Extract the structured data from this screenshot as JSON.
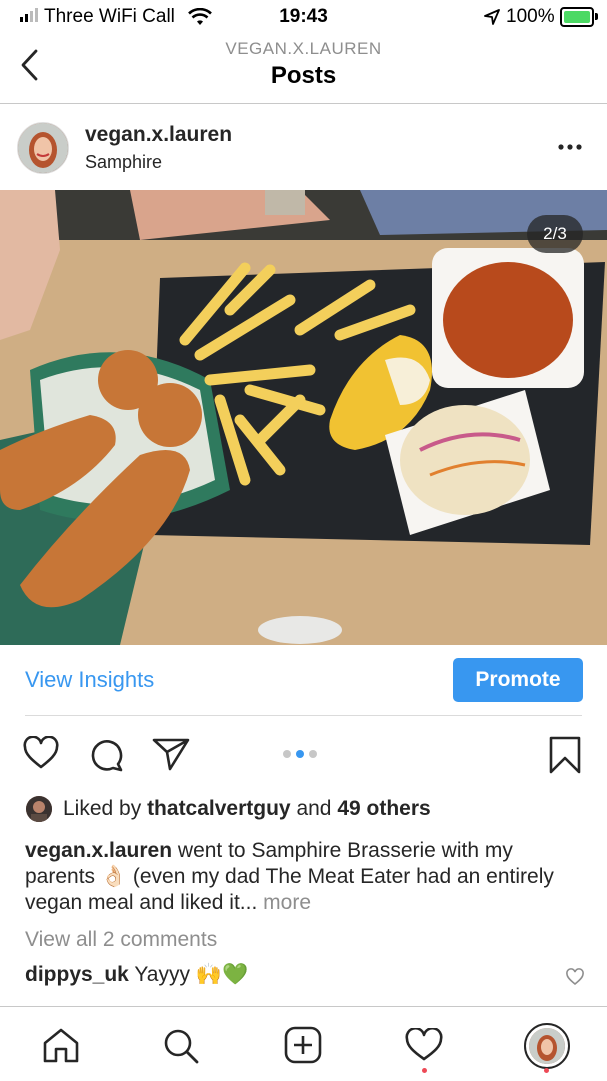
{
  "status_bar": {
    "carrier": "Three WiFi Call",
    "time": "19:43",
    "battery": "100%"
  },
  "nav": {
    "subtitle": "VEGAN.X.LAUREN",
    "title": "Posts"
  },
  "post": {
    "username": "vegan.x.lauren",
    "location": "Samphire",
    "photo_counter": "2/3",
    "carousel": {
      "total": 3,
      "current": 2
    },
    "insights_label": "View Insights",
    "promote_label": "Promote",
    "likes": {
      "prefix": "Liked by ",
      "user": "thatcalvertguy",
      "middle": " and ",
      "others": "49 others"
    },
    "caption": {
      "user": "vegan.x.lauren",
      "text": " went to Samphire Brasserie with my parents 👌🏻 (even my dad The Meat Eater had an entirely vegan meal and liked it...",
      "more": " more"
    },
    "view_comments": "View all 2 comments",
    "comment": {
      "user": "dippys_uk",
      "text": " Yayyy 🙌💚"
    }
  },
  "icons": {
    "back": "chevron-left-icon",
    "options": "more-options-icon",
    "like": "heart-icon",
    "comment": "comment-icon",
    "share": "send-icon",
    "save": "bookmark-icon",
    "tabs": [
      "home-icon",
      "search-icon",
      "add-post-icon",
      "activity-icon",
      "profile-icon"
    ]
  },
  "colors": {
    "accent": "#3897f0",
    "notification": "#ed4956",
    "battery": "#4cd964"
  }
}
